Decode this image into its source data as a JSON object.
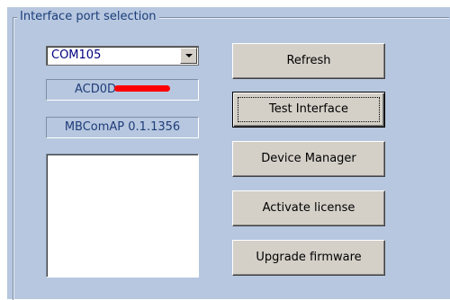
{
  "group": {
    "title": "Interface port selection"
  },
  "port_combo": {
    "value": "COM105"
  },
  "fields": {
    "serial_prefix": "ACD0D",
    "version": "MBComAP 0.1.1356"
  },
  "buttons": {
    "refresh": "Refresh",
    "test_interface": "Test Interface",
    "device_manager": "Device Manager",
    "activate_license": "Activate license",
    "upgrade_firmware": "Upgrade firmware"
  },
  "colors": {
    "panel_bg": "#b7c7df",
    "button_face": "#d4d0c8",
    "label_text": "#1a3d7a",
    "redaction": "#ff0000"
  }
}
